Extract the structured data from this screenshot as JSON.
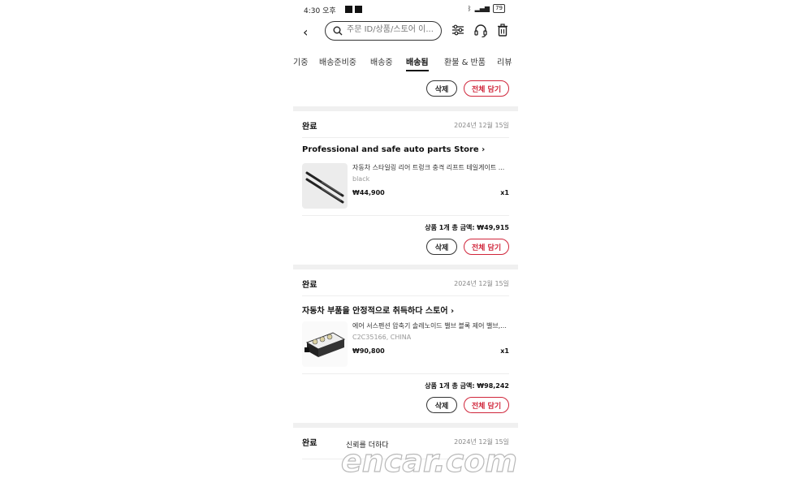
{
  "status_bar": {
    "time": "4:30 오후",
    "battery": "79"
  },
  "search": {
    "placeholder": "주문 ID/상품/스토어 이..."
  },
  "tabs": [
    {
      "label": "기중",
      "active": false
    },
    {
      "label": "배송준비중",
      "active": false
    },
    {
      "label": "배송중",
      "active": false
    },
    {
      "label": "배송됨",
      "active": true
    },
    {
      "label": "환불 & 반품",
      "active": false
    },
    {
      "label": "리뷰",
      "active": false
    }
  ],
  "actions": {
    "delete_label": "삭제",
    "add_all_label": "전체 담기"
  },
  "orders": [
    {
      "status": "완료",
      "date": "2024년 12월 15일",
      "store": "Professional and safe auto parts Store",
      "product_name": "자동차 스타일링 리어 트렁크 충격 리프트 테일게이트 ...",
      "option": "black",
      "price": "₩44,900",
      "quantity": "x1",
      "total": "상품 1개 총 금액: ₩49,915"
    },
    {
      "status": "완료",
      "date": "2024년 12월 15일",
      "store": "자동차 부품을 안정적으로 취득하다 스토어",
      "product_name": "에어 서스펜션 압축기 솔레노이드 밸브 블록 제어 밸브,...",
      "option": "C2C35166, CHINA",
      "price": "₩90,800",
      "quantity": "x1",
      "total": "상품 1개 총 금액: ₩98,242"
    },
    {
      "status": "완료",
      "date": "2024년 12월 15일"
    }
  ],
  "watermark": {
    "caption": "신뢰를 더하다",
    "logo": "encar.com"
  },
  "colors": {
    "accent": "#d0263b",
    "separator": "#f0f0f0"
  }
}
